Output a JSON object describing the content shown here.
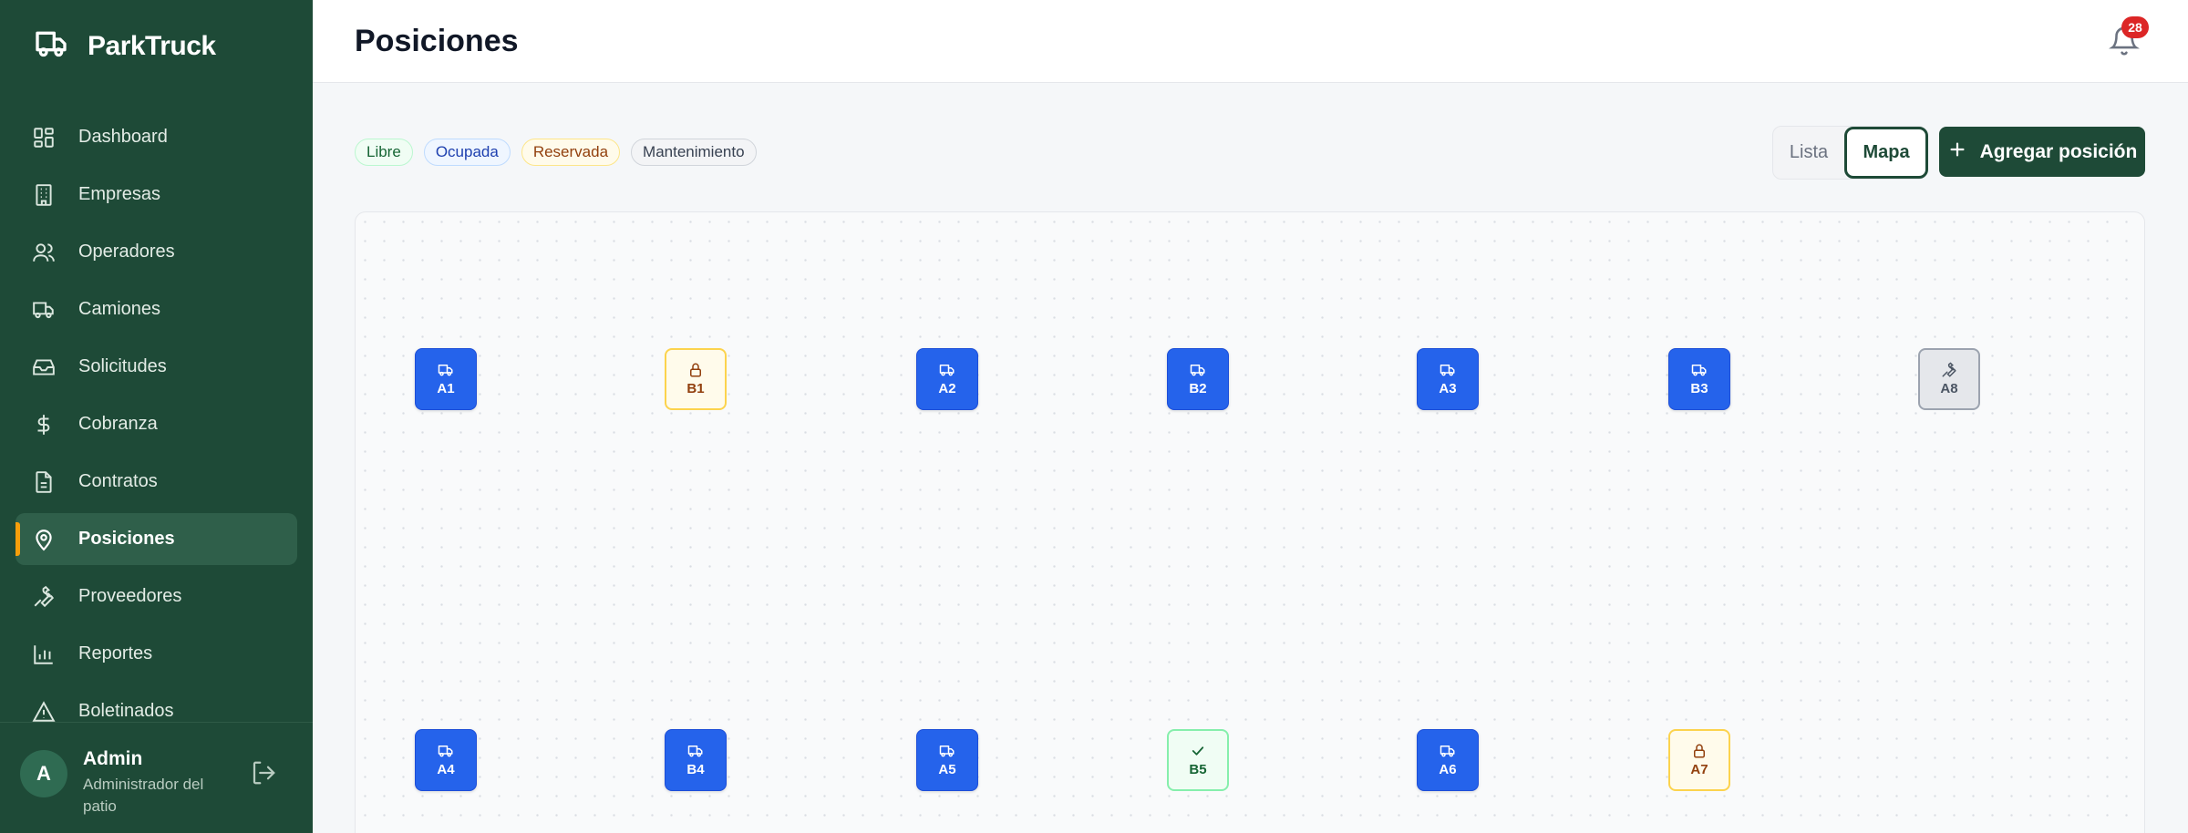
{
  "app": {
    "name": "ParkTruck"
  },
  "nav": {
    "items": [
      {
        "label": "Dashboard",
        "icon": "dashboard-icon"
      },
      {
        "label": "Empresas",
        "icon": "building-icon"
      },
      {
        "label": "Operadores",
        "icon": "users-icon"
      },
      {
        "label": "Camiones",
        "icon": "truck-icon"
      },
      {
        "label": "Solicitudes",
        "icon": "inbox-icon"
      },
      {
        "label": "Cobranza",
        "icon": "dollar-icon"
      },
      {
        "label": "Contratos",
        "icon": "file-icon"
      },
      {
        "label": "Posiciones",
        "icon": "map-pin-icon",
        "active": true
      },
      {
        "label": "Proveedores",
        "icon": "wrench-icon"
      },
      {
        "label": "Reportes",
        "icon": "bar-chart-icon"
      },
      {
        "label": "Boletinados",
        "icon": "alert-triangle-icon"
      }
    ]
  },
  "user": {
    "initial": "A",
    "name": "Admin",
    "role": "Administrador del patio"
  },
  "header": {
    "title": "Posiciones",
    "notifications": "28"
  },
  "legend": {
    "libre": "Libre",
    "ocupada": "Ocupada",
    "reservada": "Reservada",
    "mantenimiento": "Mantenimiento"
  },
  "view_toggle": {
    "lista": "Lista",
    "mapa": "Mapa",
    "selected": "Mapa"
  },
  "add_button": {
    "label": "Agregar posición"
  },
  "colors": {
    "sidebar": "#1e4a37",
    "accent": "#f59e0b",
    "ocupada": "#2563eb",
    "reservada": "#fcd34d",
    "libre": "#86efac",
    "mantenimiento": "#9ca3af"
  },
  "positions": [
    {
      "code": "A1",
      "status": "ocupada"
    },
    {
      "code": "B1",
      "status": "reservada"
    },
    {
      "code": "A2",
      "status": "ocupada"
    },
    {
      "code": "B2",
      "status": "ocupada"
    },
    {
      "code": "A3",
      "status": "ocupada"
    },
    {
      "code": "B3",
      "status": "ocupada"
    },
    {
      "code": "A8",
      "status": "mantenimiento"
    },
    {
      "code": "A4",
      "status": "ocupada"
    },
    {
      "code": "B4",
      "status": "ocupada"
    },
    {
      "code": "A5",
      "status": "ocupada"
    },
    {
      "code": "B5",
      "status": "libre"
    },
    {
      "code": "A6",
      "status": "ocupada"
    },
    {
      "code": "A7",
      "status": "reservada"
    }
  ]
}
